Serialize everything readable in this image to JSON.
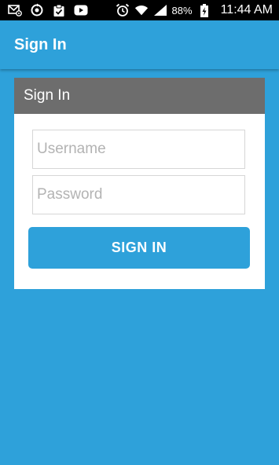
{
  "status_bar": {
    "icons_left": [
      "mail-settings-icon",
      "sync-icon",
      "clipboard-check-icon",
      "youtube-icon"
    ],
    "icons_right": [
      "alarm-icon",
      "wifi-icon",
      "signal-icon",
      "battery-charging-icon"
    ],
    "battery": "88%",
    "time": "11:44 AM"
  },
  "app_bar": {
    "title": "Sign In"
  },
  "card": {
    "title": "Sign In",
    "username": {
      "placeholder": "Username",
      "value": ""
    },
    "password": {
      "placeholder": "Password",
      "value": ""
    },
    "button_label": "SIGN IN"
  },
  "colors": {
    "primary": "#2ea1da",
    "card_header": "#6d6d6d",
    "status_bar": "#000000"
  }
}
